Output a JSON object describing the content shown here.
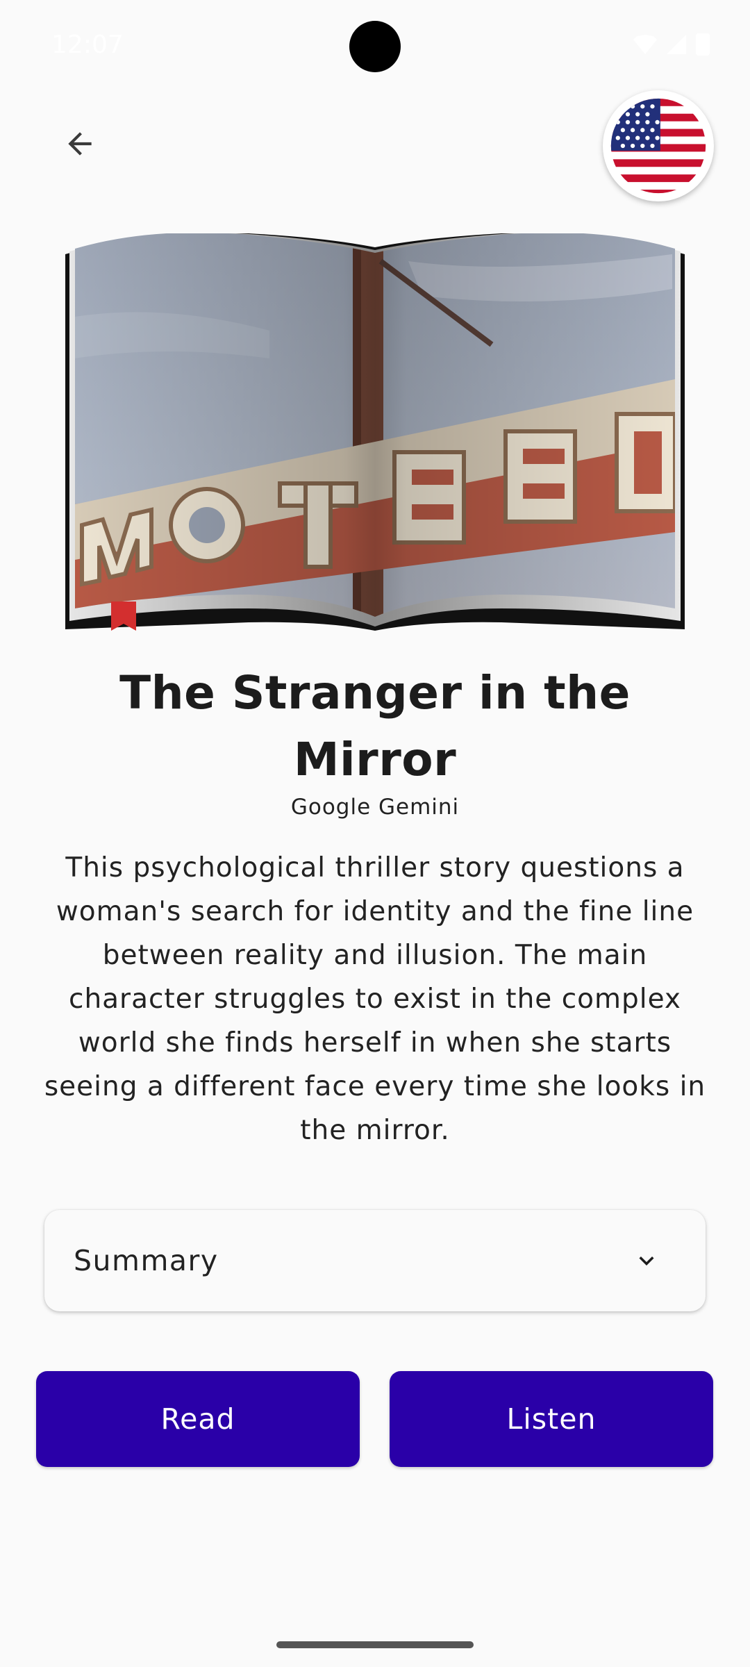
{
  "status_bar": {
    "time": "12:07",
    "icons": [
      "wifi-icon",
      "signal-icon",
      "battery-icon"
    ]
  },
  "app_bar": {
    "back_icon": "arrow-left-icon",
    "language_flag": "us-flag-icon"
  },
  "book": {
    "cover_subject": "motel-sign-photo",
    "bookmark_color": "#d32f2f",
    "title": "The Stranger in the Mirror",
    "author": "Google Gemini",
    "description": "This psychological thriller story questions a woman's search for identity and the fine line between reality and illusion. The main character struggles to exist in the complex world she finds herself in when she starts seeing a different face every time she looks in the mirror."
  },
  "dropdown": {
    "selected": "Summary",
    "icon": "chevron-down-icon"
  },
  "actions": {
    "read_label": "Read",
    "listen_label": "Listen",
    "button_color": "#2a00a8"
  }
}
